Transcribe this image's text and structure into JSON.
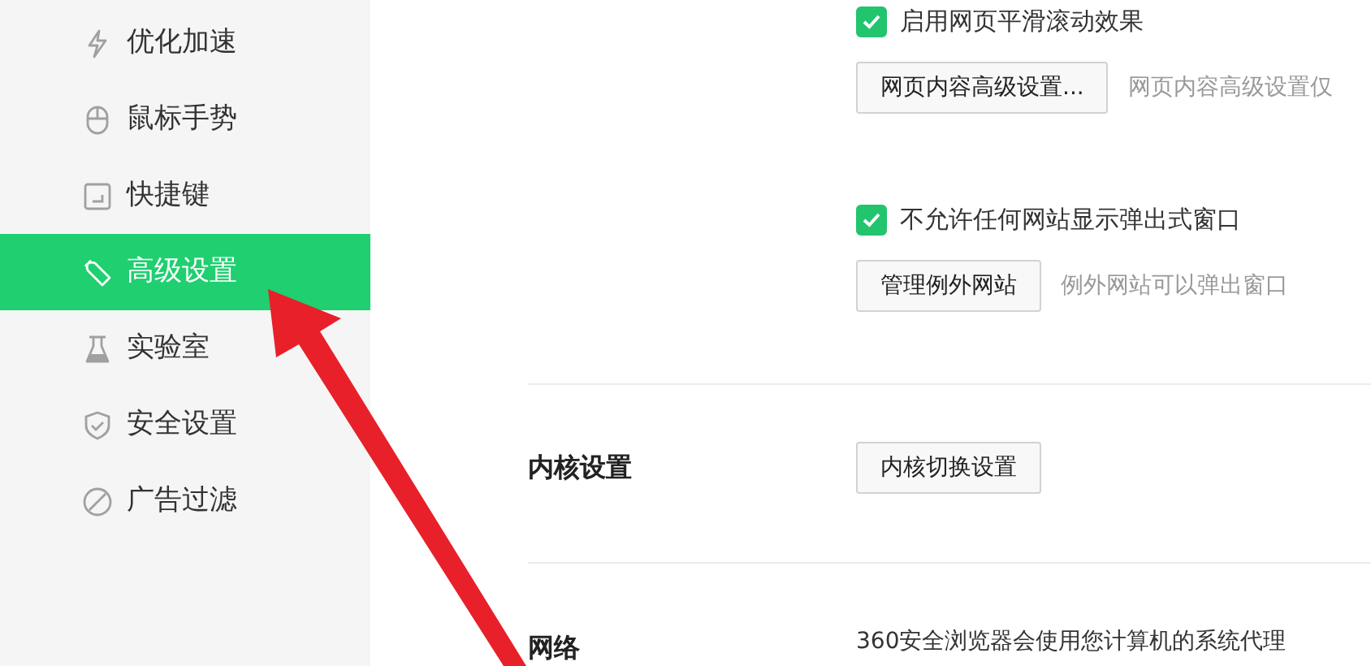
{
  "sidebar": {
    "items": [
      {
        "label": "优化加速",
        "selected": false
      },
      {
        "label": "鼠标手势",
        "selected": false
      },
      {
        "label": "快捷键",
        "selected": false
      },
      {
        "label": "高级设置",
        "selected": true
      },
      {
        "label": "实验室",
        "selected": false
      },
      {
        "label": "安全设置",
        "selected": false
      },
      {
        "label": "广告过滤",
        "selected": false
      }
    ]
  },
  "sections": [
    {
      "rows": [
        {
          "kind": "checkbox",
          "label": "启用网页平滑滚动效果",
          "checked": true
        },
        {
          "kind": "button",
          "label": "网页内容高级设置...",
          "note": "网页内容高级设置仅"
        },
        {
          "kind": "checkbox",
          "label": "不允许任何网站显示弹出式窗口",
          "checked": true
        },
        {
          "kind": "button",
          "label": "管理例外网站",
          "note": "例外网站可以弹出窗口"
        }
      ]
    },
    {
      "label": "内核设置",
      "rows": [
        {
          "kind": "button",
          "label": "内核切换设置"
        }
      ]
    },
    {
      "label": "网络",
      "rows": [
        {
          "kind": "text",
          "text": "360安全浏览器会使用您计算机的系统代理"
        }
      ]
    }
  ]
}
